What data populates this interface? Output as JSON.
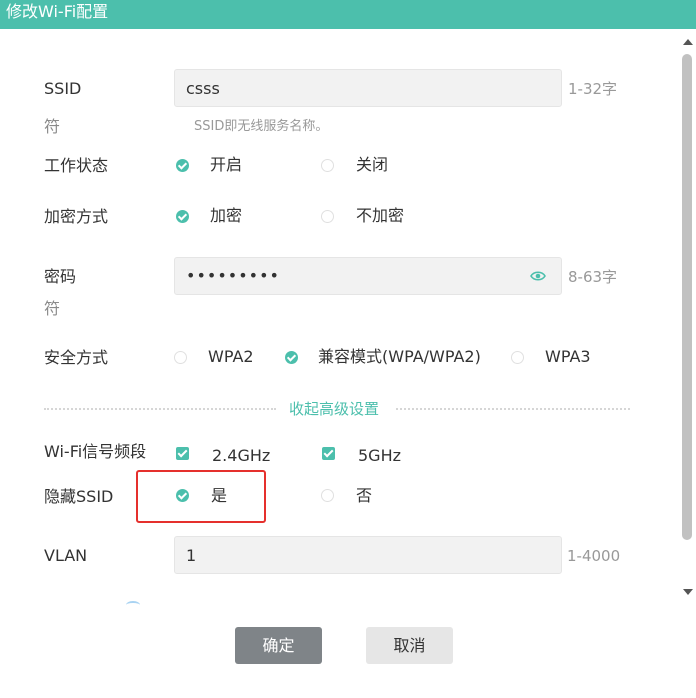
{
  "dialog": {
    "title": "修改Wi-Fi配置"
  },
  "ssid": {
    "label_line1": "SSID",
    "label_line2": "符",
    "value": "csss",
    "range": "1-32字",
    "hint": "SSID即无线服务名称。"
  },
  "work_status": {
    "label": "工作状态",
    "options": [
      "开启",
      "关闭"
    ],
    "selected": "开启"
  },
  "encryption": {
    "label": "加密方式",
    "options": [
      "加密",
      "不加密"
    ],
    "selected": "加密"
  },
  "password": {
    "label_line1": "密码",
    "label_line2": "符",
    "value": "•••••••••",
    "range": "8-63字"
  },
  "security": {
    "label": "安全方式",
    "options": [
      "WPA2",
      "兼容模式(WPA/WPA2)",
      "WPA3"
    ],
    "selected": "兼容模式(WPA/WPA2)"
  },
  "advanced": {
    "toggle_label": "收起高级设置"
  },
  "band": {
    "label": "Wi-Fi信号频段",
    "options": [
      "2.4GHz",
      "5GHz"
    ],
    "checked": [
      "2.4GHz",
      "5GHz"
    ]
  },
  "hide_ssid": {
    "label": "隐藏SSID",
    "options": [
      "是",
      "否"
    ],
    "selected": "是"
  },
  "vlan": {
    "label": "VLAN",
    "value": "1",
    "range": "1-4000"
  },
  "buttons": {
    "ok": "确定",
    "cancel": "取消"
  },
  "colors": {
    "accent": "#4cbfac",
    "highlight": "#e5302d"
  }
}
